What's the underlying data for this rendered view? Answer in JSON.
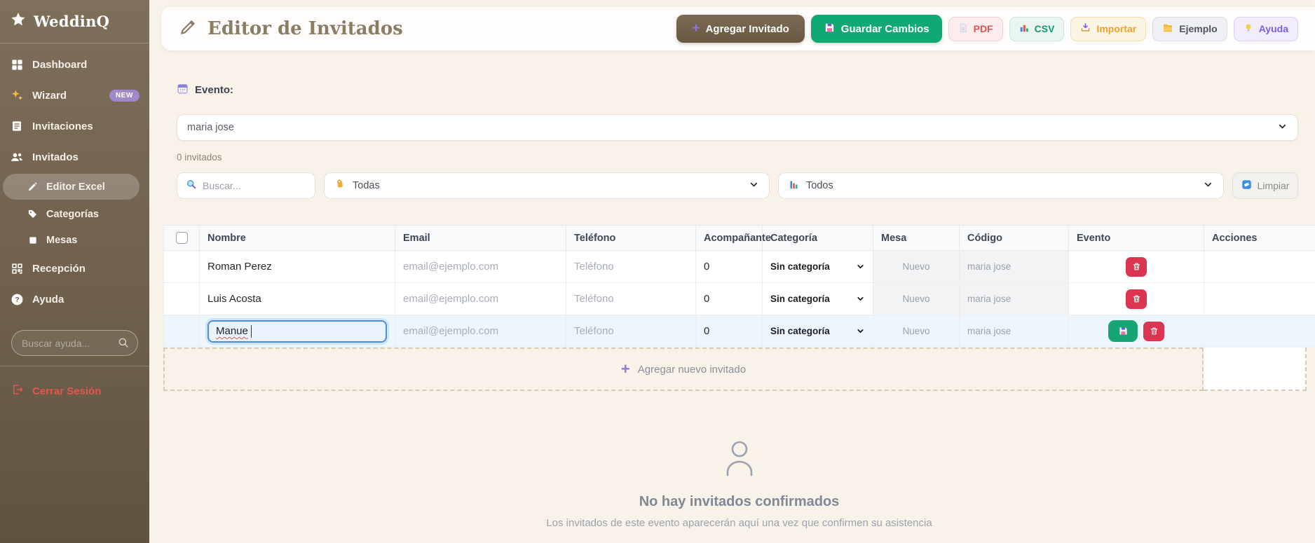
{
  "sidebar": {
    "logo": "WeddinQ",
    "items": [
      {
        "label": "Dashboard"
      },
      {
        "label": "Wizard",
        "badge": "NEW"
      },
      {
        "label": "Invitaciones"
      },
      {
        "label": "Invitados"
      },
      {
        "label": "Editor Excel"
      },
      {
        "label": "Categorías"
      },
      {
        "label": "Mesas"
      },
      {
        "label": "Recepción"
      },
      {
        "label": "Ayuda"
      }
    ],
    "help_search_placeholder": "Buscar ayuda...",
    "logout": "Cerrar Sesión"
  },
  "header": {
    "title": "Editor de Invitados",
    "add_guest": "Agregar Invitado",
    "save_changes": "Guardar Cambios",
    "pdf": "PDF",
    "csv": "CSV",
    "import": "Importar",
    "example": "Ejemplo",
    "help": "Ayuda"
  },
  "event": {
    "label": "Evento:",
    "selected": "maria jose",
    "count": "0 invitados"
  },
  "filters": {
    "search_placeholder": "Buscar...",
    "categories": "Todas",
    "status": "Todos",
    "clear": "Limpiar"
  },
  "table": {
    "columns": [
      "Nombre",
      "Email",
      "Teléfono",
      "Acompañante",
      "Categoría",
      "Mesa",
      "Código",
      "Evento",
      "Acciones"
    ],
    "rows": [
      {
        "name": "Roman Perez",
        "email_placeholder": "email@ejemplo.com",
        "phone_placeholder": "Teléfono",
        "companions": "0",
        "category": "Sin categoría",
        "mesa": "Nuevo",
        "code": "maria jose"
      },
      {
        "name": "Luis Acosta",
        "email_placeholder": "email@ejemplo.com",
        "phone_placeholder": "Teléfono",
        "companions": "0",
        "category": "Sin categoría",
        "mesa": "Nuevo",
        "code": "maria jose"
      },
      {
        "name": "Manue",
        "email_placeholder": "email@ejemplo.com",
        "phone_placeholder": "Teléfono",
        "companions": "0",
        "category": "Sin categoría",
        "mesa": "Nuevo",
        "code": "maria jose"
      }
    ],
    "add_row": "Agregar nuevo invitado"
  },
  "empty_state": {
    "title": "No hay invitados confirmados",
    "subtitle": "Los invitados de este evento aparecerán aquí una vez que confirmen su asistencia"
  },
  "colors": {
    "sidebar_brown": "#7e6f5b",
    "cream_background": "#f8f2e9",
    "primary_green": "#10a873",
    "primary_brown": "#7c6b54",
    "danger_red": "#dc3551",
    "accent_purple": "#8f7ae0",
    "focus_blue": "#4a90d9"
  }
}
